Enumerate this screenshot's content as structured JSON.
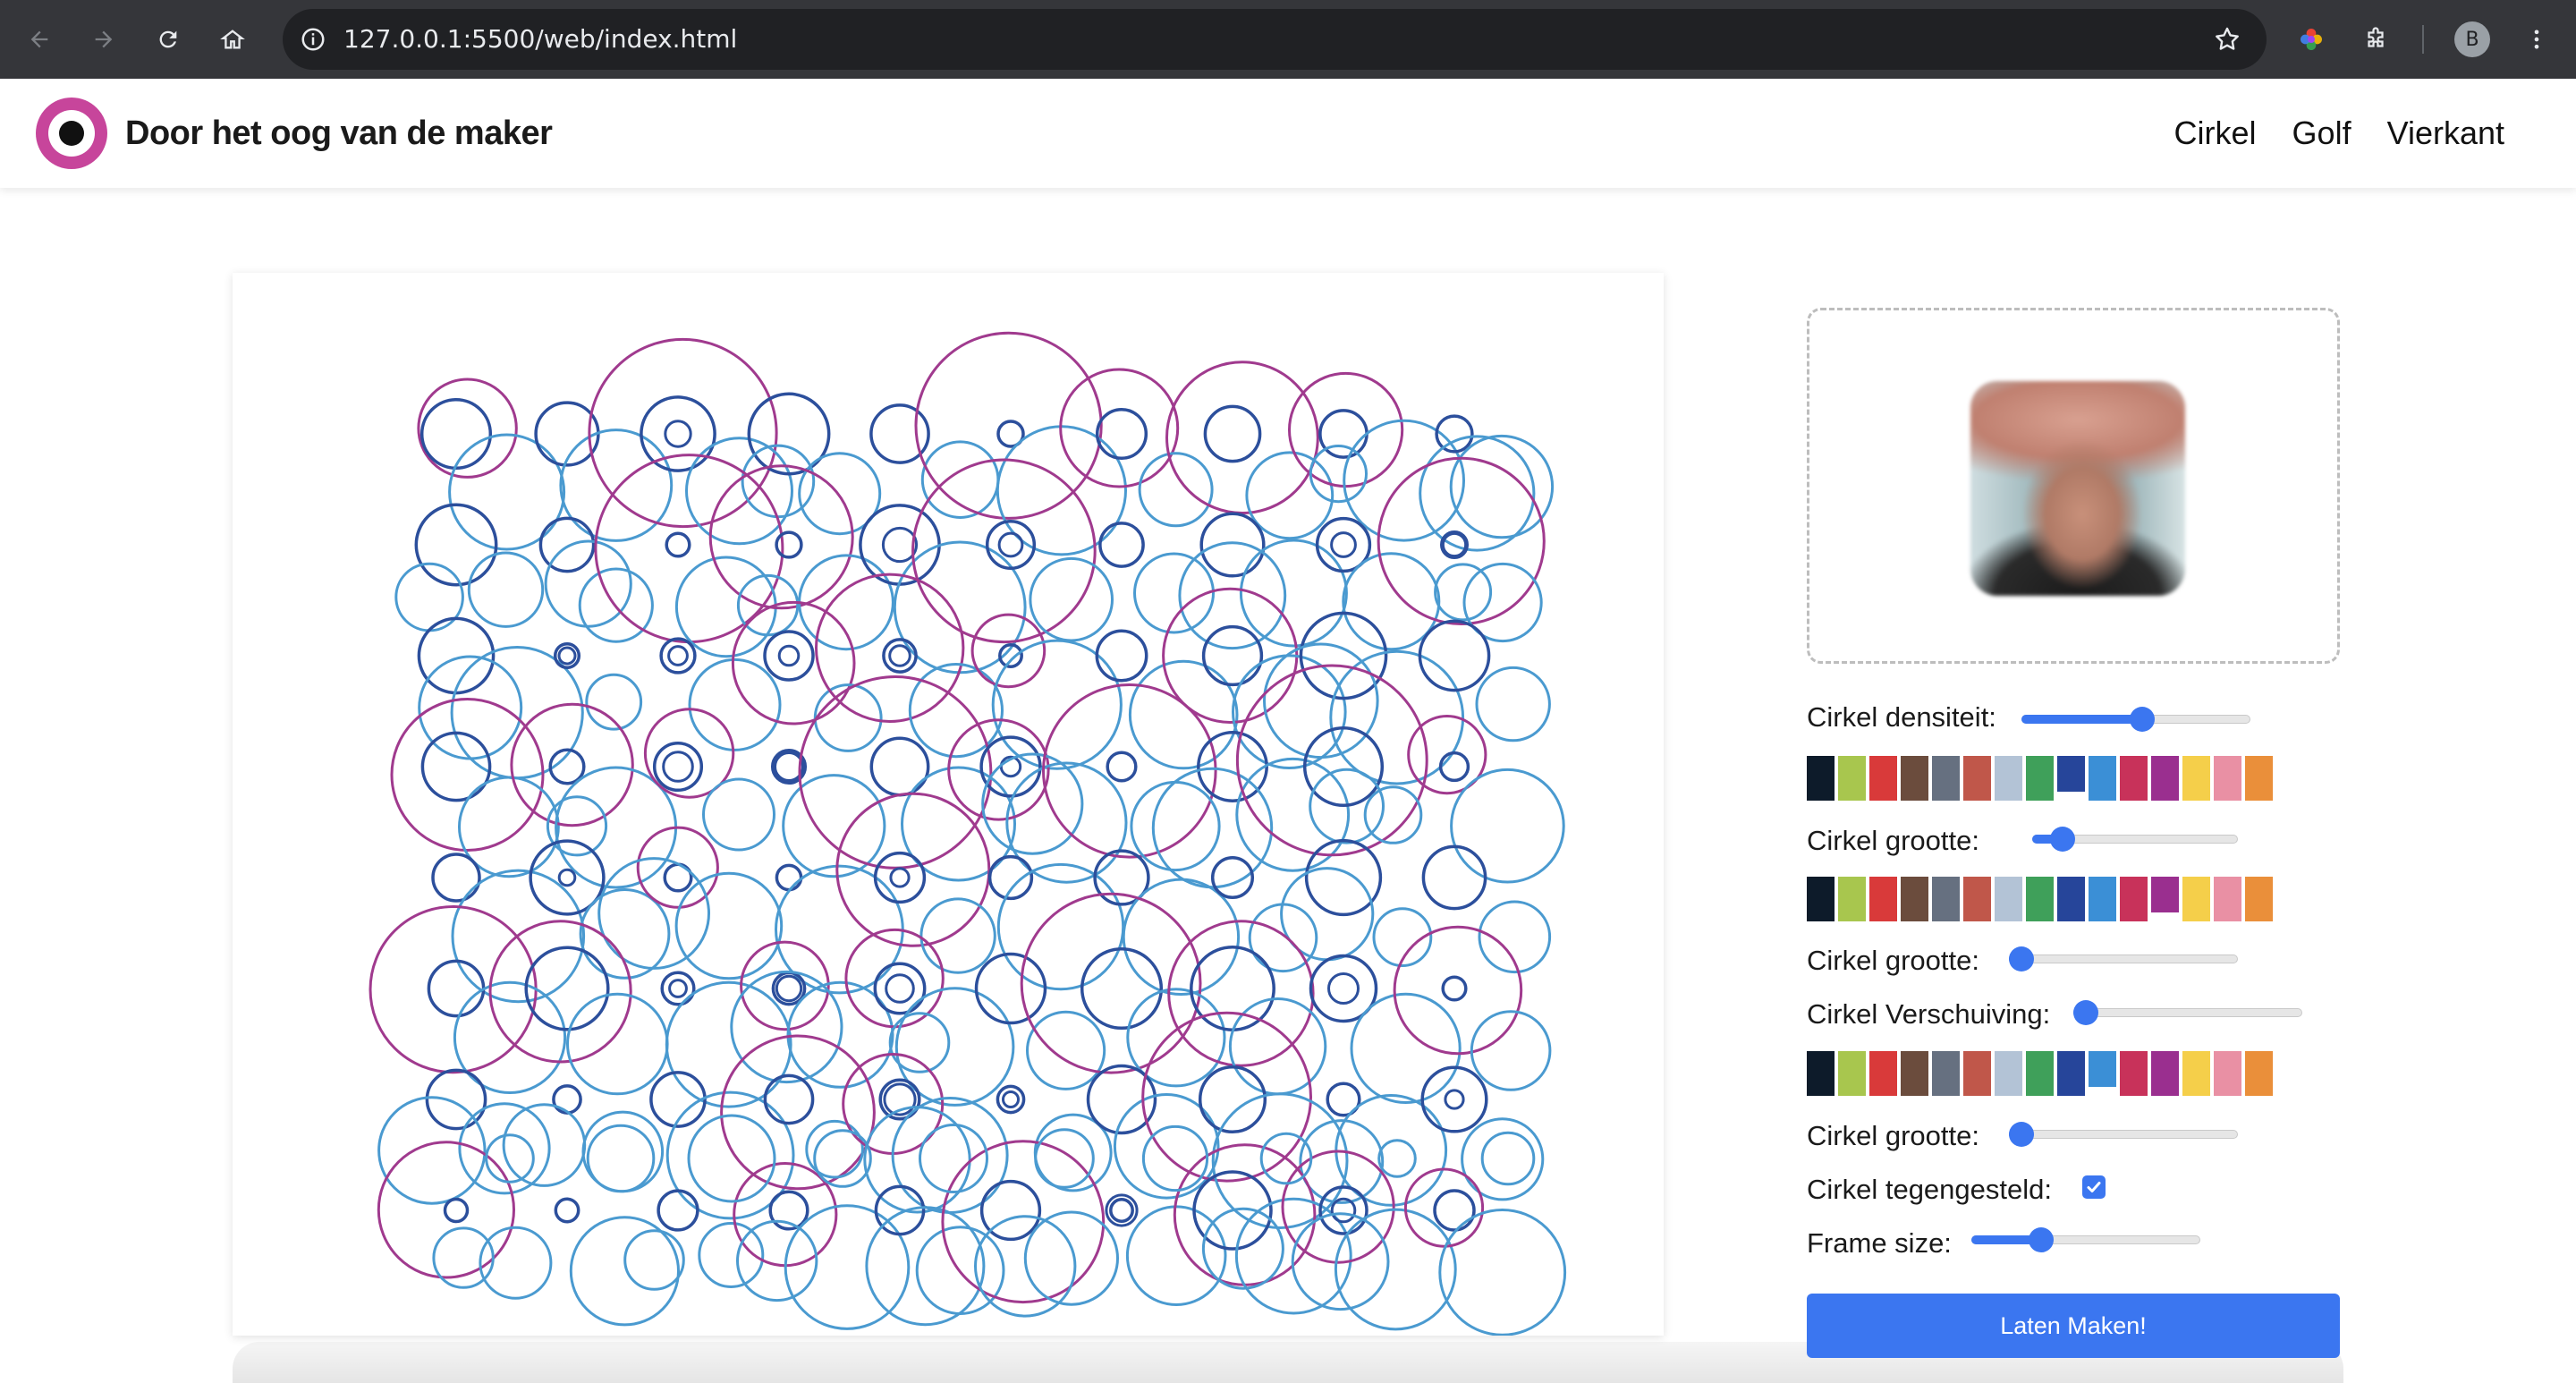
{
  "browser": {
    "url": "127.0.0.1:5500/web/index.html",
    "profile_initial": "B",
    "icons": [
      "back-icon",
      "forward-icon",
      "reload-icon",
      "home-icon",
      "info-icon",
      "star-icon",
      "extension-color-icon",
      "puzzle-icon",
      "menu-dots-icon"
    ]
  },
  "header": {
    "title": "Door het oog van de maker",
    "nav": [
      "Cirkel",
      "Golf",
      "Vierkant"
    ],
    "logo_colors": {
      "ring": "#c7459b",
      "pupil": "#111111"
    }
  },
  "controls": {
    "density_label": "Cirkel densiteit:",
    "density_value": 0.53,
    "size_label_1": "Cirkel grootte:",
    "size_value_1": 0.1,
    "size_label_2": "Cirkel grootte:",
    "size_value_2": 0.0,
    "shift_label": "Cirkel Verschuiving:",
    "shift_value": 0.0,
    "size_label_3": "Cirkel grootte:",
    "size_value_3": 0.0,
    "opposite_label": "Cirkel tegengesteld:",
    "opposite_checked": true,
    "frame_label": "Frame size:",
    "frame_value": 0.28,
    "submit_label": "Laten Maken!"
  },
  "palette_colors": [
    "#0d1b2a",
    "#a8c64e",
    "#d93a3a",
    "#6b4c3d",
    "#667080",
    "#c0574a",
    "#b3c3d6",
    "#3fa05a",
    "#26459a",
    "#3b8fd6",
    "#c8325a",
    "#9a2f8f",
    "#f5cf4a",
    "#e990a4",
    "#ea8f3a"
  ],
  "palette_selected": [
    8,
    11,
    9
  ],
  "art": {
    "colors": {
      "blue": "#4a9ad0",
      "navy": "#2c4f9c",
      "purple": "#a03a8e"
    }
  }
}
